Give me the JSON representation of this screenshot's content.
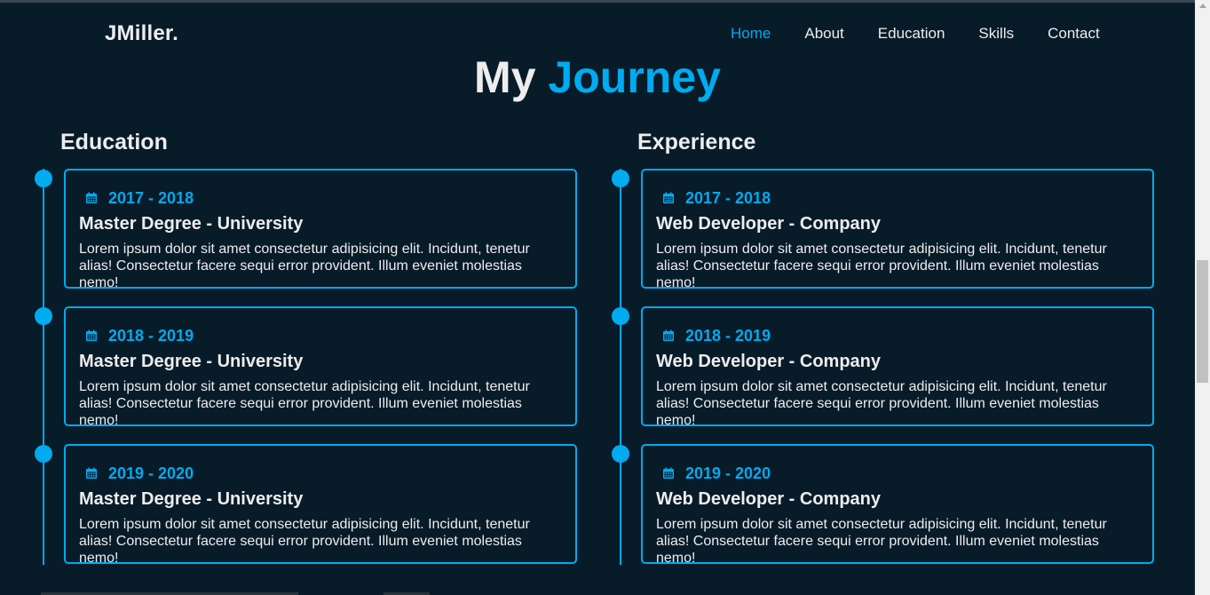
{
  "header": {
    "logo": "JMiller.",
    "nav": [
      "Home",
      "About",
      "Education",
      "Skills",
      "Contact"
    ],
    "active_nav": "Home"
  },
  "heading": {
    "main": "My",
    "accent": "Journey"
  },
  "education": {
    "title": "Education",
    "items": [
      {
        "year": "2017 - 2018",
        "title": "Master Degree - University",
        "text": "Lorem ipsum dolor sit amet consectetur adipisicing elit. Incidunt, tenetur alias! Consectetur facere sequi error provident. Illum eveniet molestias nemo!"
      },
      {
        "year": "2018 - 2019",
        "title": "Master Degree - University",
        "text": "Lorem ipsum dolor sit amet consectetur adipisicing elit. Incidunt, tenetur alias! Consectetur facere sequi error provident. Illum eveniet molestias nemo!"
      },
      {
        "year": "2019 - 2020",
        "title": "Master Degree - University",
        "text": "Lorem ipsum dolor sit amet consectetur adipisicing elit. Incidunt, tenetur alias! Consectetur facere sequi error provident. Illum eveniet molestias nemo!"
      }
    ]
  },
  "experience": {
    "title": "Experience",
    "items": [
      {
        "year": "2017 - 2018",
        "title": "Web Developer - Company",
        "text": "Lorem ipsum dolor sit amet consectetur adipisicing elit. Incidunt, tenetur alias! Consectetur facere sequi error provident. Illum eveniet molestias nemo!"
      },
      {
        "year": "2018 - 2019",
        "title": "Web Developer - Company",
        "text": "Lorem ipsum dolor sit amet consectetur adipisicing elit. Incidunt, tenetur alias! Consectetur facere sequi error provident. Illum eveniet molestias nemo!"
      },
      {
        "year": "2019 - 2020",
        "title": "Web Developer - Company",
        "text": "Lorem ipsum dolor sit amet consectetur adipisicing elit. Incidunt, tenetur alias! Consectetur facere sequi error provident. Illum eveniet molestias nemo!"
      }
    ]
  },
  "icons": {
    "date": "calendar-icon"
  },
  "colors": {
    "background": "#081b29",
    "accent": "#00abf0",
    "text": "#ededed"
  }
}
